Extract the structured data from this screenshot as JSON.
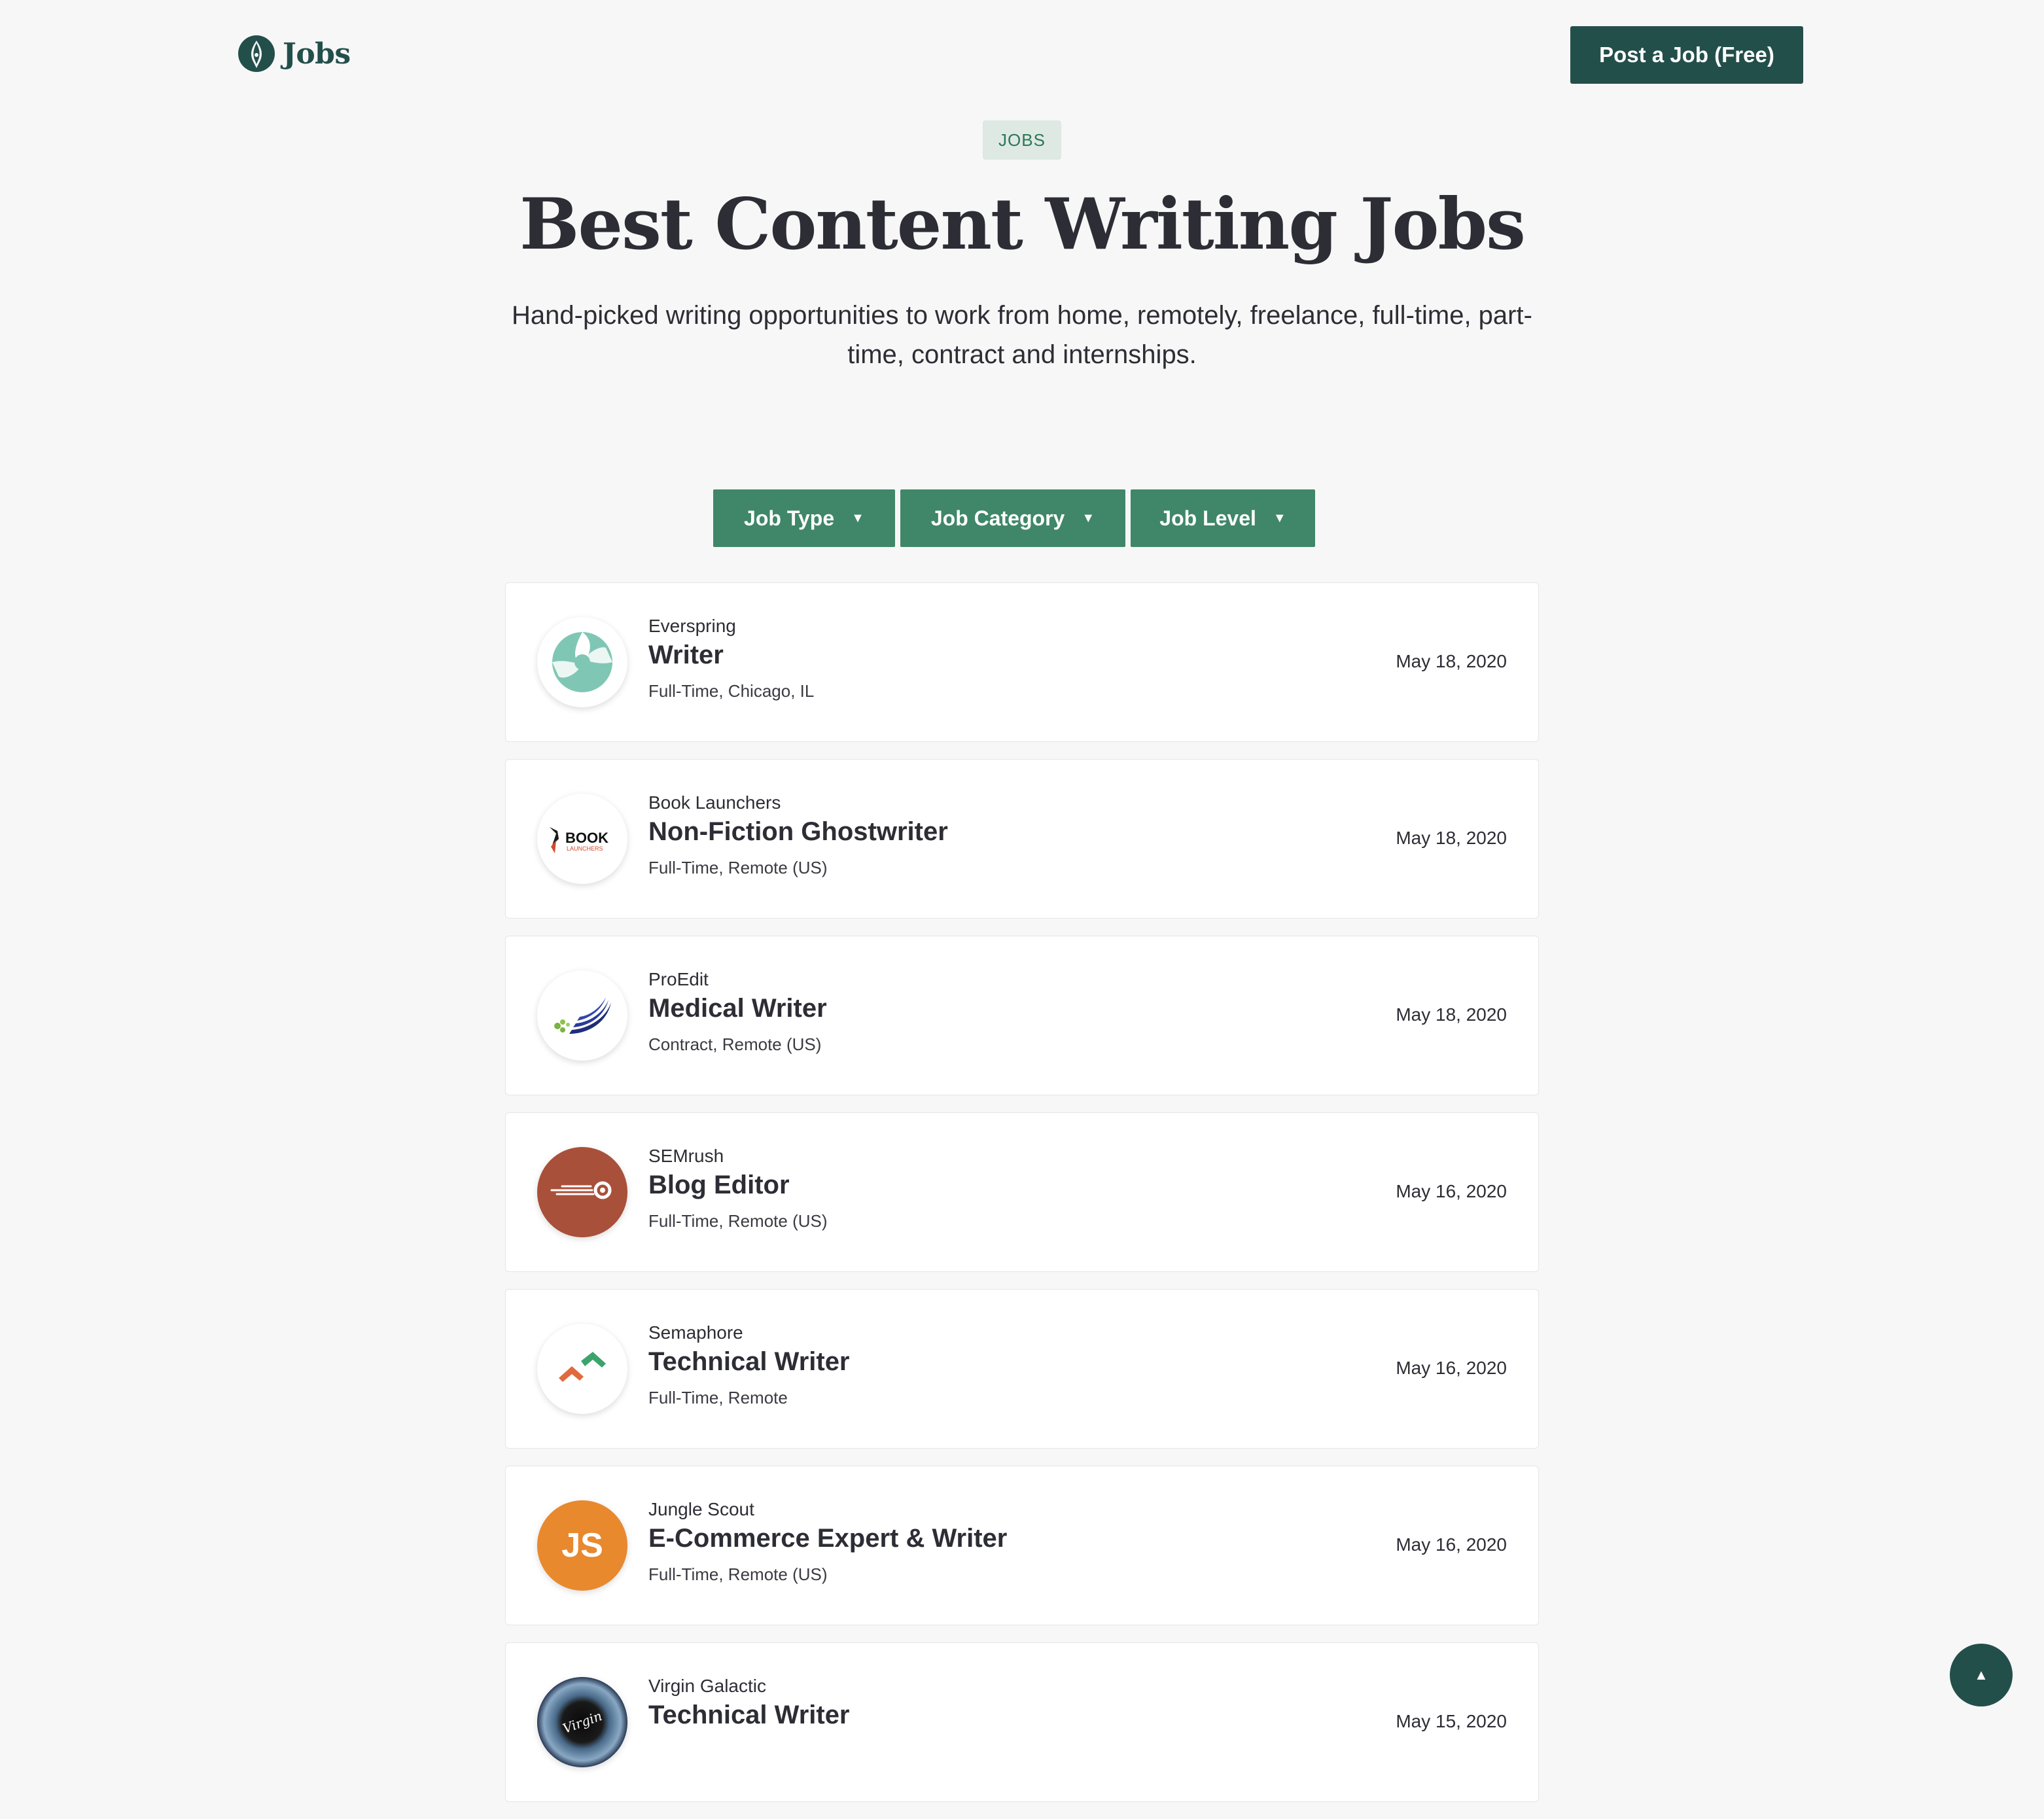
{
  "header": {
    "logo_text": "Jobs",
    "post_button": "Post a Job (Free)"
  },
  "hero": {
    "badge": "JOBS",
    "title": "Best Content Writing Jobs",
    "subtitle": "Hand-picked writing opportunities to work from home, remotely, freelance, full-time, part-time, contract and internships."
  },
  "filters": [
    {
      "label": "Job Type",
      "caret": "▼"
    },
    {
      "label": "Job Category",
      "caret": "▼"
    },
    {
      "label": "Job Level",
      "caret": "▼"
    }
  ],
  "jobs": [
    {
      "company": "Everspring",
      "title": "Writer",
      "meta": "Full-Time, Chicago, IL",
      "date": "May 18, 2020",
      "logo": "everspring-logo"
    },
    {
      "company": "Book Launchers",
      "title": "Non-Fiction Ghostwriter",
      "meta": "Full-Time, Remote (US)",
      "date": "May 18, 2020",
      "logo": "book-launchers-logo",
      "logo_text": "BOOK",
      "logo_subtext": "LAUNCHERS"
    },
    {
      "company": "ProEdit",
      "title": "Medical Writer",
      "meta": "Contract, Remote (US)",
      "date": "May 18, 2020",
      "logo": "proedit-logo"
    },
    {
      "company": "SEMrush",
      "title": "Blog Editor",
      "meta": "Full-Time, Remote (US)",
      "date": "May 16, 2020",
      "logo": "semrush-logo"
    },
    {
      "company": "Semaphore",
      "title": "Technical Writer",
      "meta": "Full-Time, Remote",
      "date": "May 16, 2020",
      "logo": "semaphore-logo"
    },
    {
      "company": "Jungle Scout",
      "title": "E-Commerce Expert & Writer",
      "meta": "Full-Time, Remote (US)",
      "date": "May 16, 2020",
      "logo": "jungle-scout-logo",
      "logo_text": "JS"
    },
    {
      "company": "Virgin Galactic",
      "title": "Technical Writer",
      "meta": "",
      "date": "May 15, 2020",
      "logo": "virgin-galactic-logo",
      "logo_text": "Virgin"
    }
  ],
  "scroll_top": {
    "icon": "▲"
  },
  "colors": {
    "brand_dark": "#234f4b",
    "filter_green": "#3f8768",
    "badge_bg": "#dfe9e3",
    "badge_text": "#2a7856",
    "page_bg": "#f7f7f7"
  }
}
